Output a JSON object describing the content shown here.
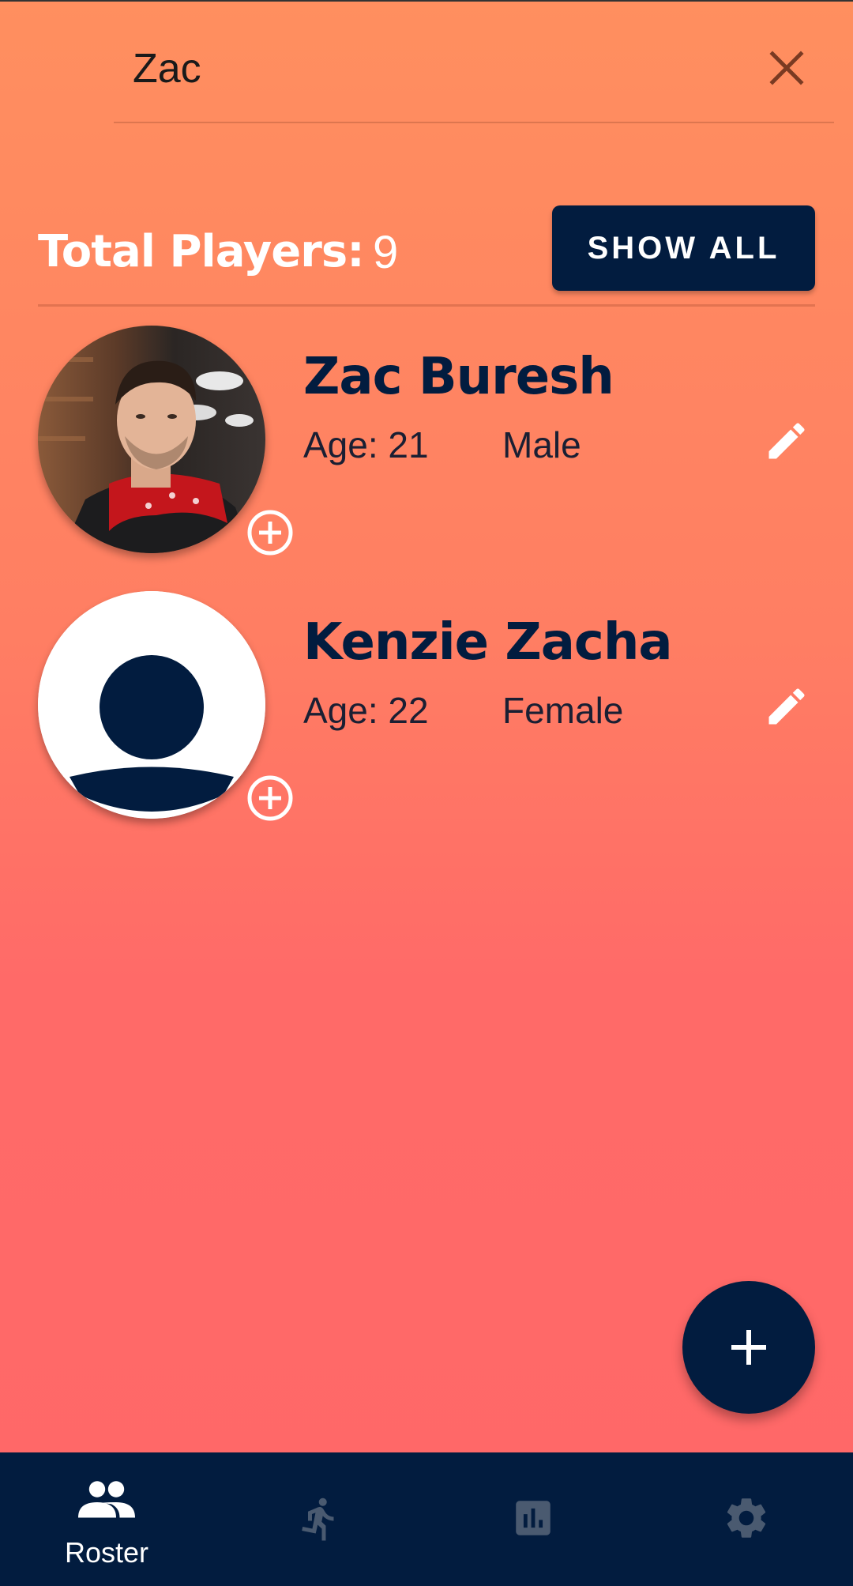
{
  "search": {
    "value": "Zac",
    "clear_icon": "close-icon"
  },
  "summary": {
    "total_label": "Total Players:",
    "total_count": "9",
    "show_all_label": "SHOW ALL"
  },
  "players": [
    {
      "name": "Zac Buresh",
      "age": "Age: 21",
      "gender": "Male",
      "avatar": "photo",
      "add_icon": "add-circle-icon",
      "edit_icon": "pencil-icon"
    },
    {
      "name": "Kenzie Zacha",
      "age": "Age: 22",
      "gender": "Female",
      "avatar": "default-person",
      "add_icon": "add-circle-icon",
      "edit_icon": "pencil-icon"
    }
  ],
  "fab": {
    "icon": "plus-icon"
  },
  "nav": {
    "items": [
      {
        "label": "Roster",
        "icon": "people-icon",
        "active": true
      },
      {
        "label": "",
        "icon": "running-icon",
        "active": false
      },
      {
        "label": "",
        "icon": "bar-chart-icon",
        "active": false
      },
      {
        "label": "",
        "icon": "gear-icon",
        "active": false
      }
    ]
  },
  "colors": {
    "navy": "#021C3F",
    "gradient_top": "#FF8F5F",
    "gradient_bottom": "#FF6868",
    "inactive_icon": "#4A5A70"
  }
}
